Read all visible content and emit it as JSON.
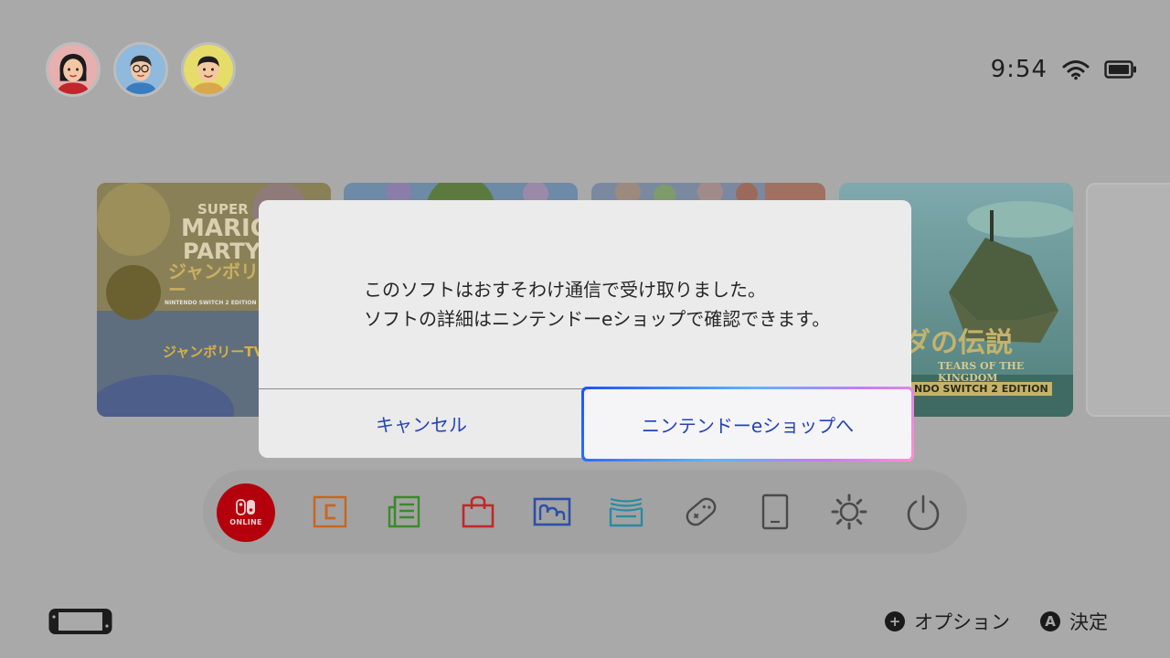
{
  "status": {
    "time": "9:54"
  },
  "users": [
    {
      "name": "user-1",
      "skin": "#f2c7a6",
      "hair": "#1b1b1b",
      "bg": "#e7b0ae"
    },
    {
      "name": "user-2",
      "skin": "#f2c7a6",
      "hair": "#2b2b2b",
      "bg": "#8fb9dd"
    },
    {
      "name": "user-3",
      "skin": "#f5c9a0",
      "hair": "#1e1e1e",
      "bg": "#e6dc6a"
    }
  ],
  "tiles": {
    "mario_party": {
      "line1": "SUPER",
      "line2": "MARIO",
      "line3": "PARTY",
      "line4": "ジャンボリー",
      "line5": "NINTENDO SWITCH 2 EDITION",
      "line6": "ジャンボリーTV",
      "line7": "TV"
    },
    "zelda": {
      "title": "ルダの伝説",
      "sub": "TEARS OF THE KINGDOM",
      "edition": "NDO SWITCH 2 EDITION"
    }
  },
  "dialog": {
    "message_line1": "このソフトはおすそわけ通信で受け取りました。",
    "message_line2": "ソフトの詳細はニンテンドーeショップで確認できます。",
    "cancel_label": "キャンセル",
    "eshop_label": "ニンテンドーeショップへ"
  },
  "dock": {
    "online_label": "ONLINE",
    "items": [
      {
        "icon": "game-chat-icon",
        "color": "#c8651f"
      },
      {
        "icon": "news-icon",
        "color": "#3a8a2a"
      },
      {
        "icon": "eshop-icon",
        "color": "#c0282c"
      },
      {
        "icon": "album-icon",
        "color": "#2c4fa8"
      },
      {
        "icon": "game-card-icon",
        "color": "#2a8aa0"
      },
      {
        "icon": "controllers-icon",
        "color": "#4a4a4a"
      },
      {
        "icon": "tv-mode-icon",
        "color": "#4a4a4a"
      },
      {
        "icon": "settings-icon",
        "color": "#4a4a4a"
      },
      {
        "icon": "power-icon",
        "color": "#4a4a4a"
      }
    ]
  },
  "footer": {
    "options_symbol": "+",
    "options_label": "オプション",
    "confirm_symbol": "A",
    "confirm_label": "決定"
  }
}
